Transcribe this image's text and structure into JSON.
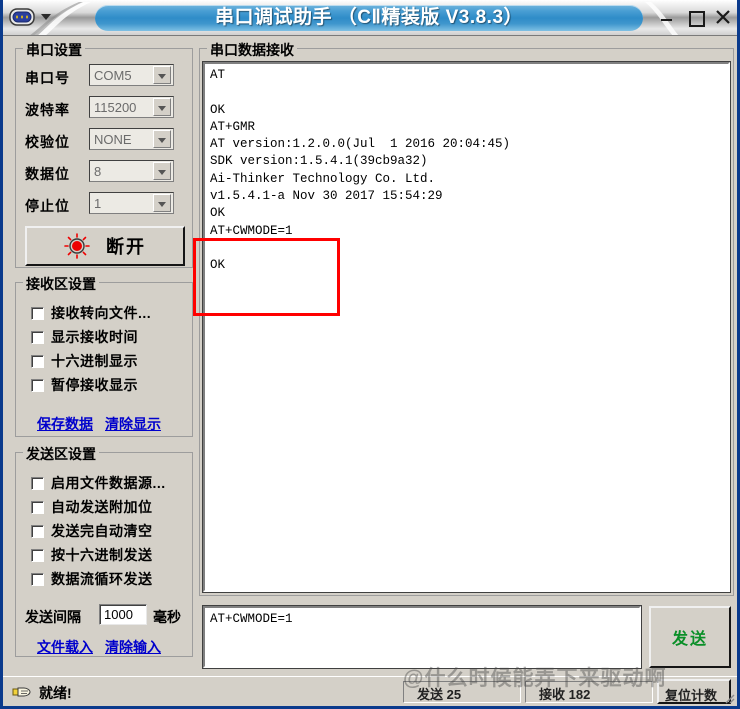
{
  "window": {
    "title": "串口调试助手 （CⅡ精装版 V3.8.3）",
    "sysicon_name": "serial-port-icon",
    "minimize_label": "–",
    "maximize_label": "□",
    "close_label": "✕"
  },
  "serial_settings": {
    "group_label": "串口设置",
    "rows": [
      {
        "label": "串口号",
        "value": "COM5"
      },
      {
        "label": "波特率",
        "value": "115200"
      },
      {
        "label": "校验位",
        "value": "NONE"
      },
      {
        "label": "数据位",
        "value": "8"
      },
      {
        "label": "停止位",
        "value": "1"
      }
    ],
    "connect_button": "断开"
  },
  "receive_settings": {
    "group_label": "接收区设置",
    "checkboxes": [
      {
        "label": "接收转向文件...",
        "checked": false
      },
      {
        "label": "显示接收时间",
        "checked": false
      },
      {
        "label": "十六进制显示",
        "checked": false
      },
      {
        "label": "暂停接收显示",
        "checked": false
      }
    ],
    "links": [
      {
        "label": "保存数据"
      },
      {
        "label": "清除显示"
      }
    ]
  },
  "send_settings": {
    "group_label": "发送区设置",
    "checkboxes": [
      {
        "label": "启用文件数据源...",
        "checked": false
      },
      {
        "label": "自动发送附加位",
        "checked": false
      },
      {
        "label": "发送完自动清空",
        "checked": false
      },
      {
        "label": "按十六进制发送",
        "checked": false
      },
      {
        "label": "数据流循环发送",
        "checked": false
      }
    ],
    "interval_label": "发送间隔",
    "interval_value": "1000",
    "interval_unit": "毫秒",
    "links": [
      {
        "label": "文件载入"
      },
      {
        "label": "清除输入"
      }
    ]
  },
  "receive_area": {
    "group_label": "串口数据接收",
    "content": "AT\n\nOK\nAT+GMR\nAT version:1.2.0.0(Jul  1 2016 20:04:45)\nSDK version:1.5.4.1(39cb9a32)\nAi-Thinker Technology Co. Ltd.\nv1.5.4.1-a Nov 30 2017 15:54:29\nOK\nAT+CWMODE=1\n\nOK"
  },
  "send_area": {
    "input_value": "AT+CWMODE=1",
    "send_button": "发送"
  },
  "status_bar": {
    "ready_text": "就绪!",
    "ready_icon": "pointing-hand-icon",
    "send_count_label": "发送 25",
    "receive_count_label": "接收 182",
    "reset_button": "复位计数",
    "watermark_text": "@什么时候能弄下来驱动啊"
  },
  "colors": {
    "title_accent": "#2f8cc8",
    "window_face": "#d4d0c8",
    "link": "#0000cc",
    "send_button_text": "#0a8f28",
    "led_red": "#ee0000",
    "annotation_red": "#ff0000"
  }
}
